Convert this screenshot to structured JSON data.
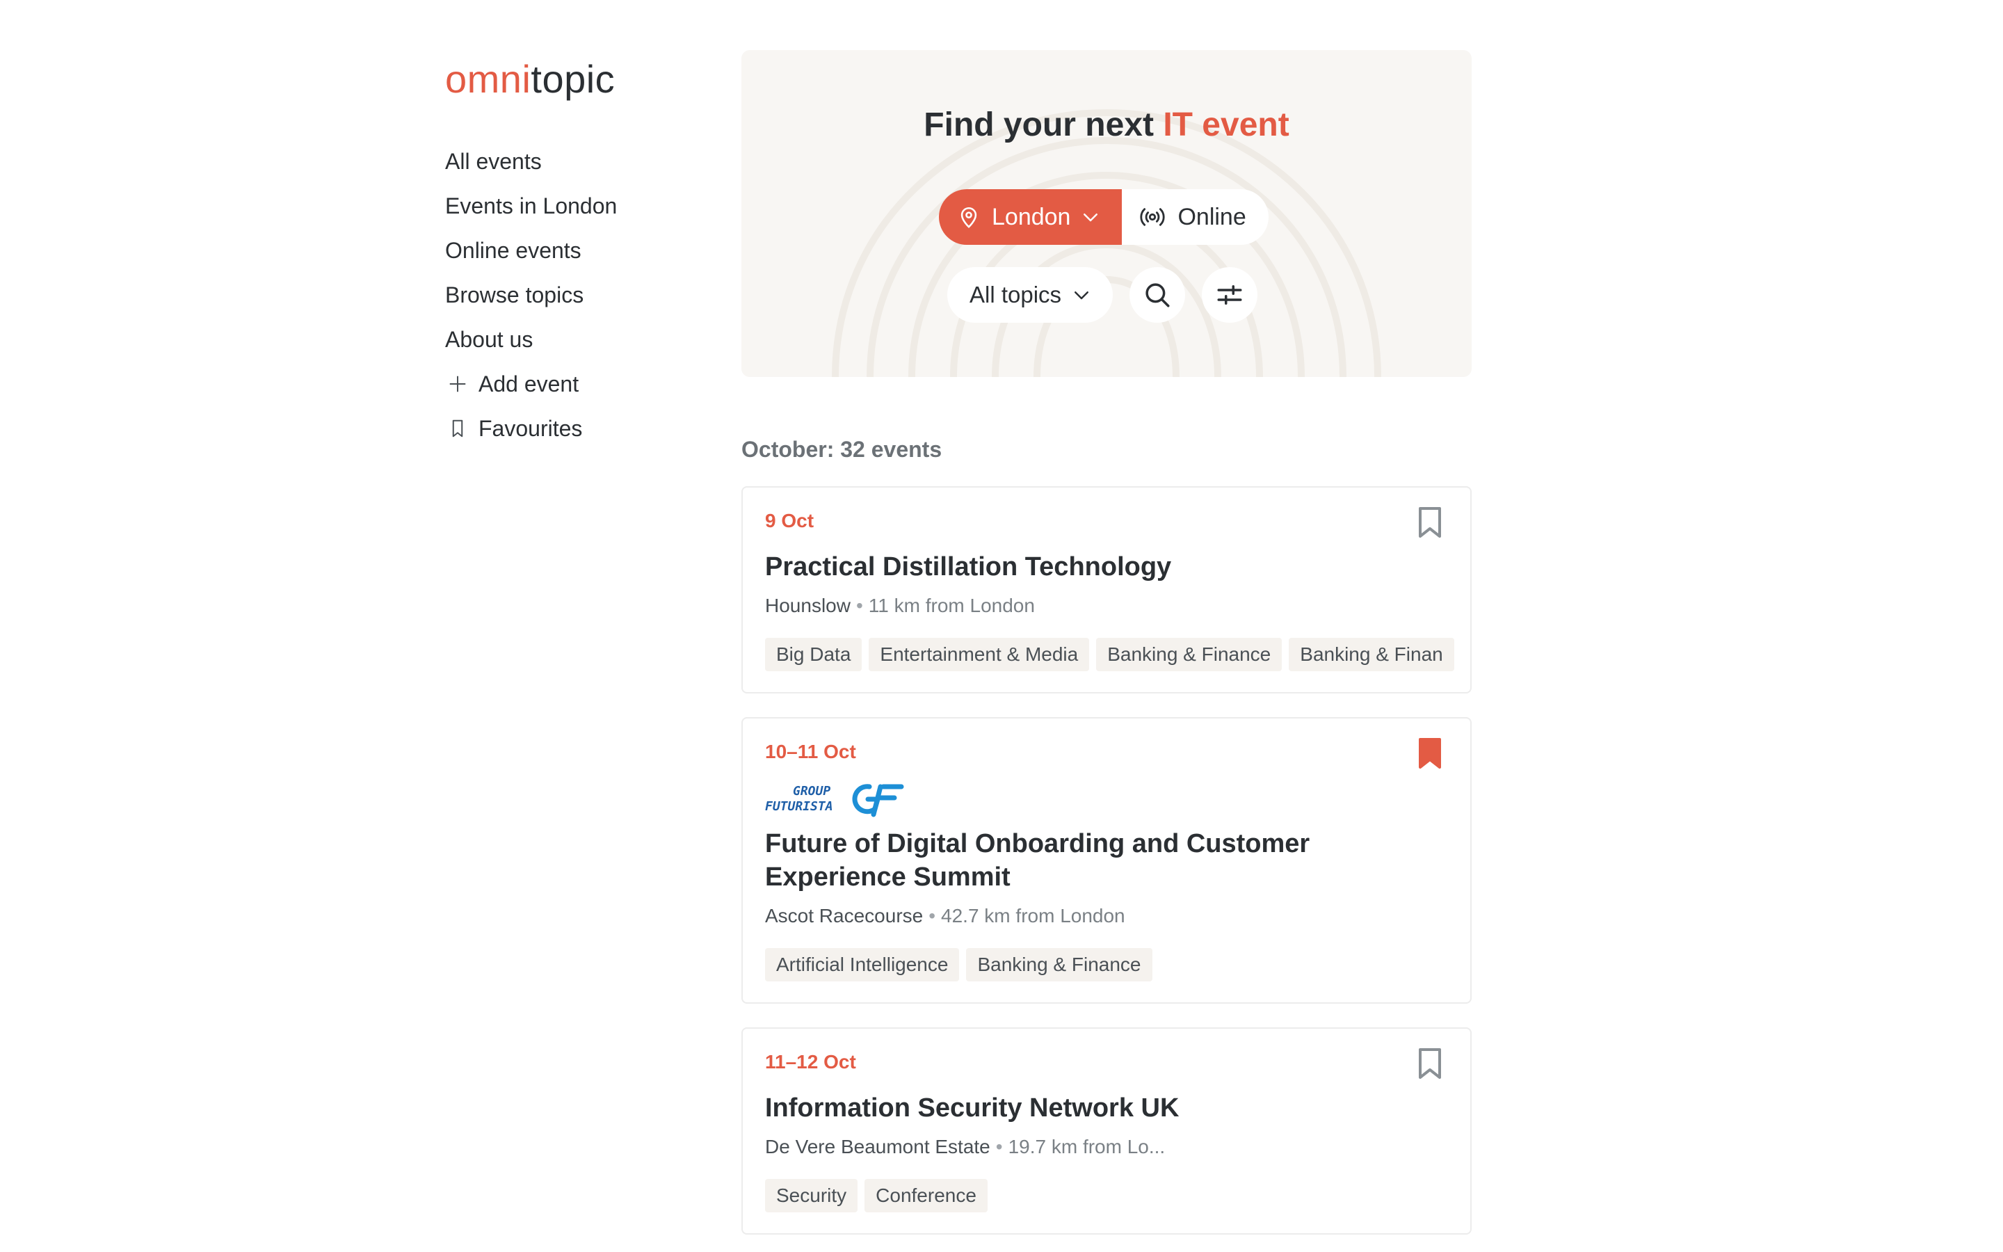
{
  "brand": {
    "part1": "omni",
    "part2": "topic",
    "accent_color": "#e35b44"
  },
  "nav": {
    "all_events": "All events",
    "events_in_london": "Events in London",
    "online_events": "Online events",
    "browse_topics": "Browse topics",
    "about_us": "About us",
    "add_event": "Add event",
    "favourites": "Favourites"
  },
  "hero": {
    "title_prefix": "Find your next ",
    "title_accent": "IT event",
    "location_label": "London",
    "online_label": "Online",
    "topics_label": "All topics"
  },
  "month_heading": "October: 32 events",
  "events": [
    {
      "date": "9 Oct",
      "title": "Practical Distillation Technology",
      "venue": "Hounslow",
      "distance": "11 km from London",
      "bookmarked": false,
      "tags": [
        "Big Data",
        "Entertainment & Media",
        "Banking & Finance",
        "Banking & Finan"
      ]
    },
    {
      "date": "10–11 Oct",
      "organizer_logo": "GROUP FUTURISTA",
      "title": "Future of Digital Onboarding and Customer Experience Summit",
      "venue": "Ascot Racecourse",
      "distance": "42.7 km from London",
      "bookmarked": true,
      "tags": [
        "Artificial Intelligence",
        "Banking & Finance"
      ]
    },
    {
      "date": "11–12 Oct",
      "title": "Information Security Network UK",
      "venue": "De Vere Beaumont Estate",
      "distance": "19.7 km from Lo...",
      "bookmarked": false,
      "tags": [
        "Security",
        "Conference"
      ]
    }
  ]
}
